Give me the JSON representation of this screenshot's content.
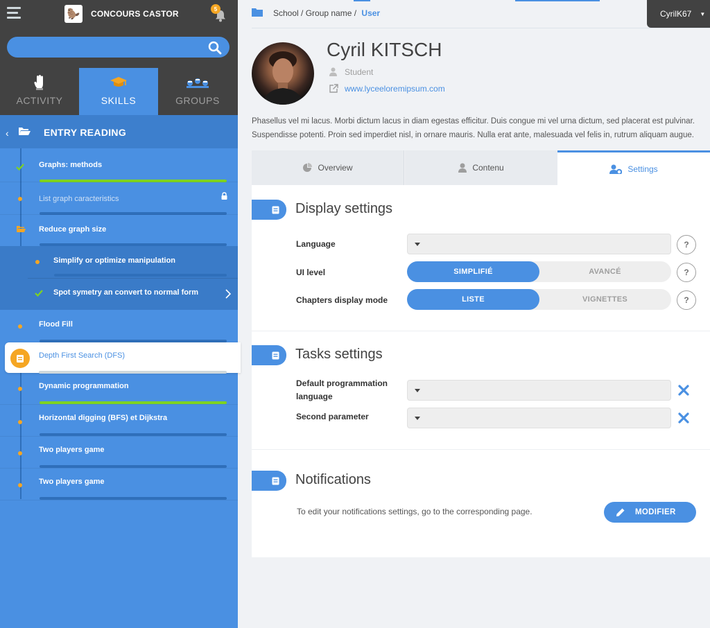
{
  "app": {
    "title": "CONCOURS CASTOR",
    "notifications": "5"
  },
  "search": {
    "placeholder": ""
  },
  "tabs": [
    {
      "label": "ACTIVITY",
      "active": false
    },
    {
      "label": "SKILLS",
      "active": true
    },
    {
      "label": "GROUPS",
      "active": false
    }
  ],
  "chapter": {
    "title": "ENTRY READING"
  },
  "tree": {
    "items": [
      {
        "label": "Graphs: methods",
        "state": "done",
        "progress": 1.0
      },
      {
        "label": "List graph caracteristics",
        "state": "locked",
        "progress": 0
      },
      {
        "label": "Reduce graph size",
        "state": "open-folder",
        "progress": 0
      },
      {
        "label": "Simplify or optimize manipulation",
        "state": "todo"
      },
      {
        "label": "Spot symetry an convert to normal form",
        "state": "done"
      },
      {
        "label": "Flood Fill",
        "state": "todo",
        "progress": 0
      },
      {
        "label": "Depth First Search (DFS)",
        "state": "current",
        "progress": 0
      },
      {
        "label": "Dynamic programmation",
        "state": "todo",
        "progress": 1.0
      },
      {
        "label": "Horizontal digging (BFS) et Dijkstra",
        "state": "todo",
        "progress": 0
      },
      {
        "label": "Two players game",
        "state": "todo",
        "progress": 0
      },
      {
        "label": "Two players game",
        "state": "todo",
        "progress": 0
      }
    ]
  },
  "breadcrumb": {
    "path": "School / Group name /",
    "current": "User"
  },
  "user_menu": {
    "label": "CyrilK67"
  },
  "profile": {
    "name": "Cyril KITSCH",
    "role": "Student",
    "url": "www.lyceeloremipsum.com",
    "description": "Phasellus vel mi lacus. Morbi dictum lacus in diam egestas efficitur. Duis congue mi vel urna dictum, sed placerat est pulvinar. Suspendisse potenti. Proin sed imperdiet nisl, in ornare mauris. Nulla erat ante, malesuada vel felis in, rutrum aliquam augue."
  },
  "profile_tabs": [
    {
      "label": "Overview"
    },
    {
      "label": "Contenu"
    },
    {
      "label": "Settings",
      "active": true
    }
  ],
  "display_settings": {
    "title": "Display settings",
    "language_label": "Language",
    "language_value": "",
    "ui_level_label": "UI level",
    "ui_level_options": [
      "SIMPLIFIÉ",
      "AVANCÉ"
    ],
    "ui_level_selected": "SIMPLIFIÉ",
    "chapters_label": "Chapters display mode",
    "chapters_options": [
      "LISTE",
      "VIGNETTES"
    ],
    "chapters_selected": "LISTE",
    "help": "?"
  },
  "tasks_settings": {
    "title": "Tasks settings",
    "default_lang_label_1": "Default programmation",
    "default_lang_label_2": "language",
    "default_lang_value": "",
    "second_param_label": "Second parameter",
    "second_param_value": ""
  },
  "notifications": {
    "title": "Notifications",
    "text": "To edit your notifications settings, go to the corresponding page.",
    "button": "MODIFIER"
  },
  "colors": {
    "primary": "#4a90e2",
    "dark": "#424242",
    "accent": "#f5a623",
    "success": "#7ed321"
  }
}
